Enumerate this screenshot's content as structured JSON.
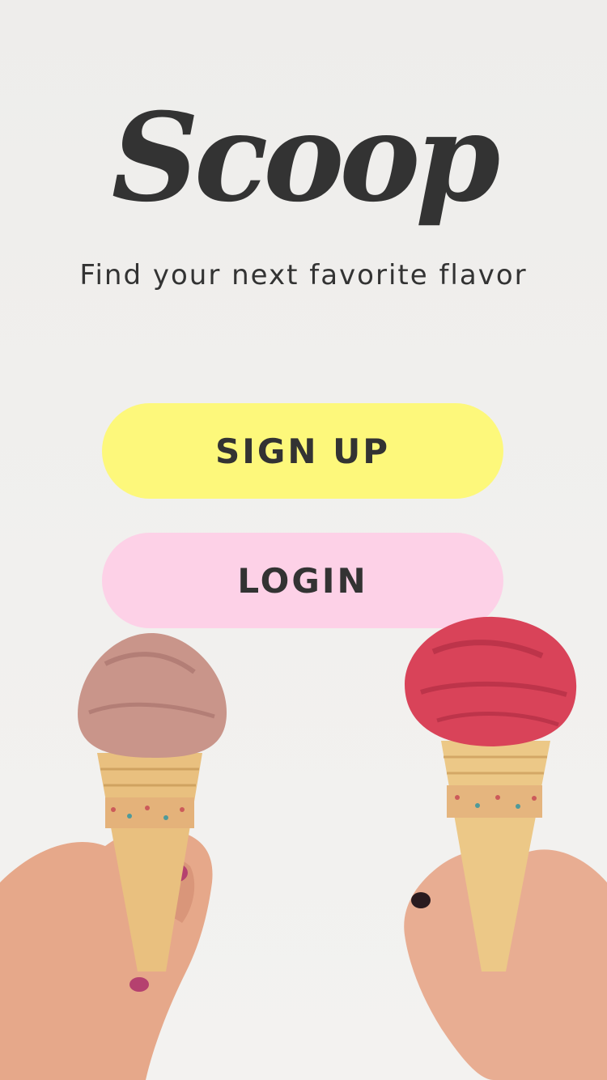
{
  "app": {
    "logo_text": "Scoop",
    "tagline": "Find your next favorite flavor"
  },
  "actions": {
    "signup_label": "SIGN UP",
    "login_label": "LOGIN"
  },
  "colors": {
    "text": "#333333",
    "signup_bg": "#fdf87b",
    "login_bg": "#fdd1e7",
    "background": "#efeeec"
  },
  "illustration": {
    "icon": "ice-cream-cones-photo"
  }
}
